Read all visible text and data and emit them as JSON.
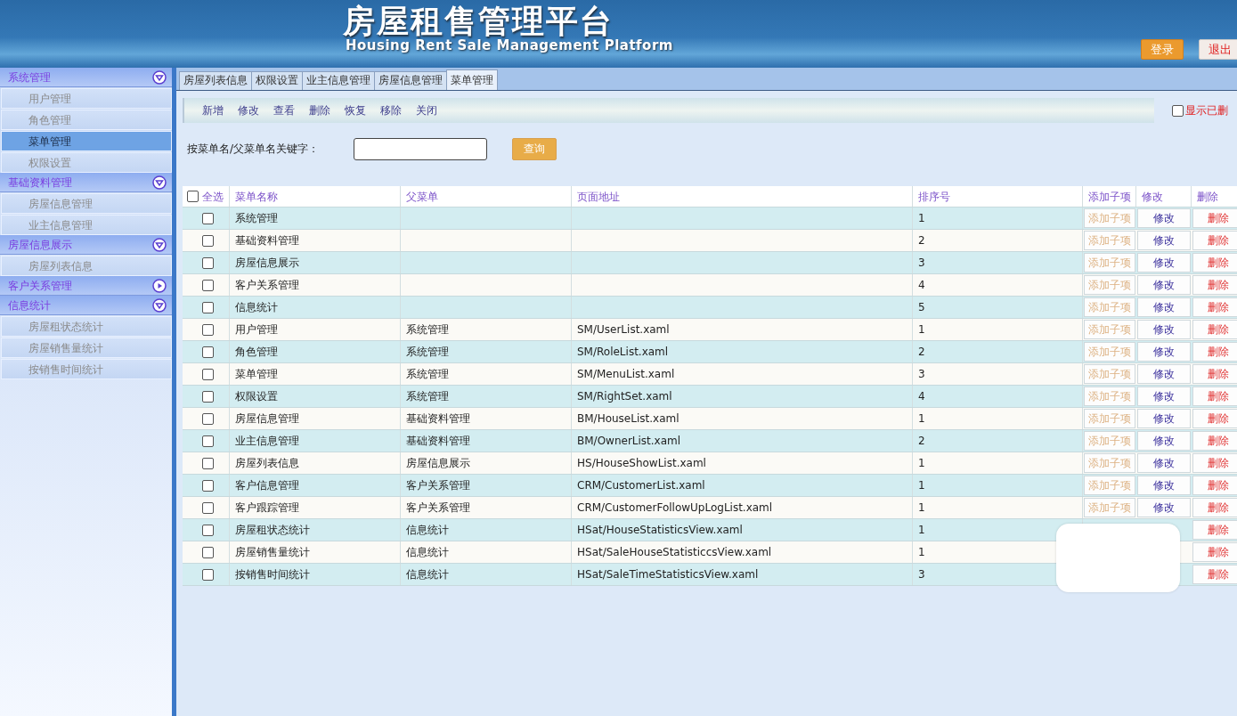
{
  "header": {
    "title": "房屋租售管理平台",
    "subtitle": "Housing Rent Sale Management Platform",
    "buttons": [
      {
        "label": "登录",
        "kind": "login"
      },
      {
        "label": "退出",
        "kind": "logout"
      }
    ]
  },
  "sidebar": {
    "groups": [
      {
        "label": "系统管理",
        "expanded": true,
        "items": [
          {
            "label": "用户管理",
            "selected": false
          },
          {
            "label": "角色管理",
            "selected": false
          },
          {
            "label": "菜单管理",
            "selected": true
          },
          {
            "label": "权限设置",
            "selected": false
          }
        ]
      },
      {
        "label": "基础资料管理",
        "expanded": true,
        "items": [
          {
            "label": "房屋信息管理",
            "selected": false
          },
          {
            "label": "业主信息管理",
            "selected": false
          }
        ]
      },
      {
        "label": "房屋信息展示",
        "expanded": true,
        "items": [
          {
            "label": "房屋列表信息",
            "selected": false
          }
        ]
      },
      {
        "label": "客户关系管理",
        "expanded": false
      },
      {
        "label": "信息统计",
        "expanded": true,
        "items": [
          {
            "label": "房屋租状态统计",
            "selected": false
          },
          {
            "label": "房屋销售量统计",
            "selected": false
          },
          {
            "label": "按销售时间统计",
            "selected": false
          }
        ]
      }
    ]
  },
  "tabs": [
    {
      "label": "房屋列表信息",
      "selected": false
    },
    {
      "label": "权限设置",
      "selected": false
    },
    {
      "label": "业主信息管理",
      "selected": false
    },
    {
      "label": "房屋信息管理",
      "selected": false
    },
    {
      "label": "菜单管理",
      "selected": true
    }
  ],
  "toolbar": [
    "新增",
    "修改",
    "查看",
    "删除",
    "恢复",
    "移除",
    "关闭"
  ],
  "show_deleted": {
    "label": "显示已删",
    "checked": false
  },
  "search": {
    "label": "按菜单名/父菜单名关键字：",
    "button": "查询"
  },
  "table": {
    "select_all": {
      "label": "全选",
      "checked": false
    },
    "columns": [
      "菜单名称",
      "父菜单",
      "页面地址",
      "排序号",
      "添加子项",
      "修改",
      "删除"
    ],
    "rows": [
      {
        "checked": false,
        "name": "系统管理",
        "order": "1",
        "add": "添加子项",
        "edit": "修改",
        "delete": "删除"
      },
      {
        "checked": false,
        "name": "基础资料管理",
        "order": "2",
        "add": "添加子项",
        "edit": "修改",
        "delete": "删除"
      },
      {
        "checked": false,
        "name": "房屋信息展示",
        "order": "3",
        "add": "添加子项",
        "edit": "修改",
        "delete": "删除"
      },
      {
        "checked": false,
        "name": "客户关系管理",
        "order": "4",
        "add": "添加子项",
        "edit": "修改",
        "delete": "删除"
      },
      {
        "checked": false,
        "name": "信息统计",
        "order": "5",
        "add": "添加子项",
        "edit": "修改",
        "delete": "删除"
      },
      {
        "checked": false,
        "name": "用户管理",
        "parent": "系统管理",
        "url": "SM/UserList.xaml",
        "order": "1",
        "add": "添加子项",
        "edit": "修改",
        "delete": "删除"
      },
      {
        "checked": false,
        "name": "角色管理",
        "parent": "系统管理",
        "url": "SM/RoleList.xaml",
        "order": "2",
        "add": "添加子项",
        "edit": "修改",
        "delete": "删除"
      },
      {
        "checked": false,
        "name": "菜单管理",
        "parent": "系统管理",
        "url": "SM/MenuList.xaml",
        "order": "3",
        "add": "添加子项",
        "edit": "修改",
        "delete": "删除"
      },
      {
        "checked": false,
        "name": "权限设置",
        "parent": "系统管理",
        "url": "SM/RightSet.xaml",
        "order": "4",
        "add": "添加子项",
        "edit": "修改",
        "delete": "删除"
      },
      {
        "checked": false,
        "name": "房屋信息管理",
        "parent": "基础资料管理",
        "url": "BM/HouseList.xaml",
        "order": "1",
        "add": "添加子项",
        "edit": "修改",
        "delete": "删除"
      },
      {
        "checked": false,
        "name": "业主信息管理",
        "parent": "基础资料管理",
        "url": "BM/OwnerList.xaml",
        "order": "2",
        "add": "添加子项",
        "edit": "修改",
        "delete": "删除"
      },
      {
        "checked": false,
        "name": "房屋列表信息",
        "parent": "房屋信息展示",
        "url": "HS/HouseShowList.xaml",
        "order": "1",
        "add": "添加子项",
        "edit": "修改",
        "delete": "删除"
      },
      {
        "checked": false,
        "name": "客户信息管理",
        "parent": "客户关系管理",
        "url": "CRM/CustomerList.xaml",
        "order": "1",
        "add": "添加子项",
        "edit": "修改",
        "delete": "删除"
      },
      {
        "checked": false,
        "name": "客户跟踪管理",
        "parent": "客户关系管理",
        "url": "CRM/CustomerFollowUpLogList.xaml",
        "order": "1",
        "add": "添加子项",
        "edit": "修改",
        "delete": "删除"
      },
      {
        "checked": false,
        "name": "房屋租状态统计",
        "parent": "信息统计",
        "url": "HSat/HouseStatisticsView.xaml",
        "order": "1",
        "delete": "删除"
      },
      {
        "checked": false,
        "name": "房屋销售量统计",
        "parent": "信息统计",
        "url": "HSat/SaleHouseStatisticcsView.xaml",
        "order": "1",
        "delete": "删除"
      },
      {
        "checked": false,
        "name": "按销售时间统计",
        "parent": "信息统计",
        "url": "HSat/SaleTimeStatisticsView.xaml",
        "order": "3",
        "delete": "删除"
      }
    ]
  }
}
